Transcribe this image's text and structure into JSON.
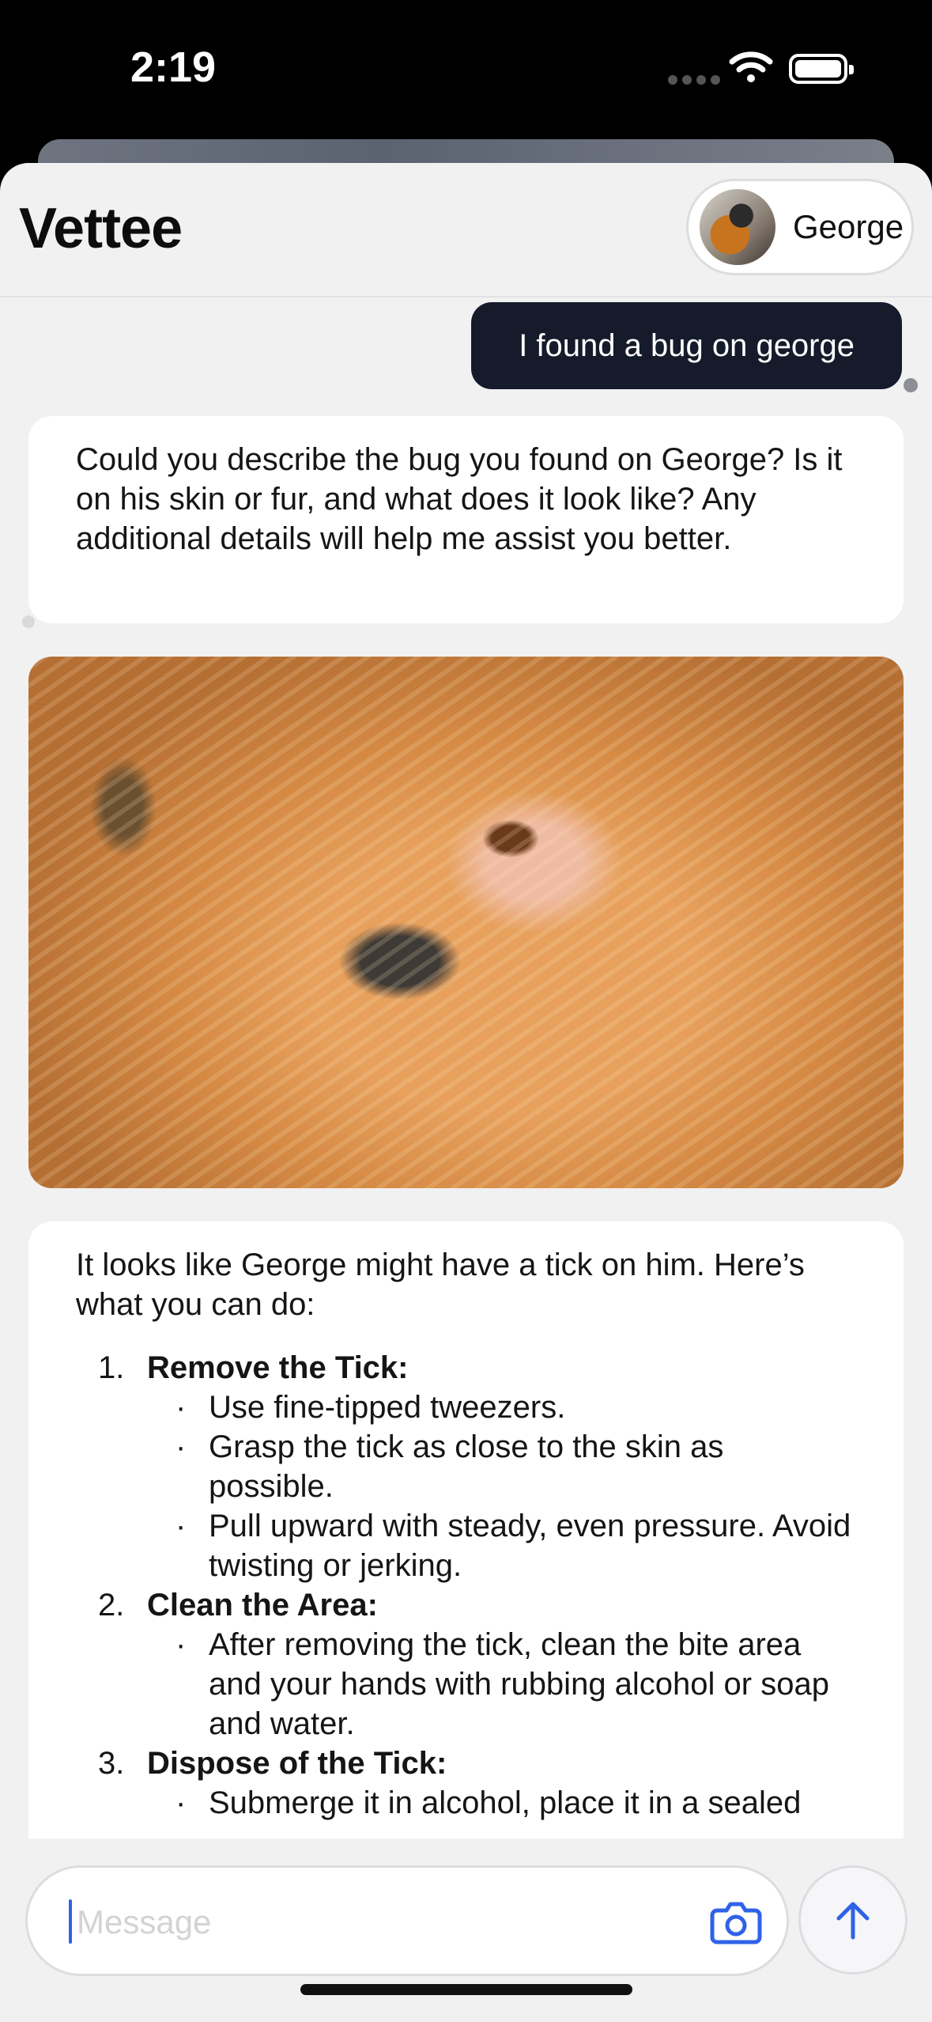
{
  "status_bar": {
    "time": "2:19"
  },
  "header": {
    "app_title": "Vettee",
    "pet_name": "George"
  },
  "messages": {
    "user_1": "I found a bug on george",
    "bot_1": "Could you describe the bug you found on George? Is it on his skin or fur, and what does it look like? Any additional details will help me assist you better.",
    "bot_2_intro": "It looks like George might have a tick on him. Here’s what you can do:",
    "steps": [
      {
        "num": "1.",
        "title": "Remove the Tick:",
        "bullets": [
          "Use fine-tipped tweezers.",
          "Grasp the tick as close to the skin as possible.",
          "Pull upward with steady, even pressure. Avoid twisting or jerking."
        ]
      },
      {
        "num": "2.",
        "title": "Clean the Area:",
        "bullets": [
          "After removing the tick, clean the bite area and your hands with rubbing alcohol or soap and water."
        ]
      },
      {
        "num": "3.",
        "title": "Dispose of the Tick:",
        "bullets": [
          "Submerge it in alcohol, place it in a sealed"
        ]
      }
    ]
  },
  "composer": {
    "placeholder": "Message"
  },
  "colors": {
    "accent": "#2f62e8",
    "user_bubble": "#151b2b",
    "background": "#f1f1f2"
  },
  "icons": [
    "wifi-icon",
    "battery-icon",
    "camera-icon",
    "arrow-up-icon"
  ]
}
